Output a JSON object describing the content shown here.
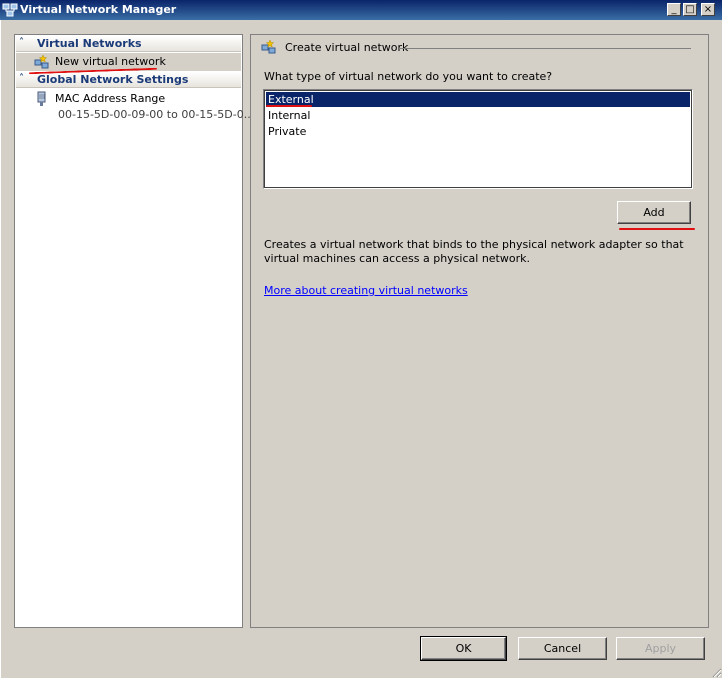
{
  "window": {
    "title": "Virtual Network Manager",
    "controls": {
      "minimize": "_",
      "maximize": "□",
      "close": "×"
    }
  },
  "sidebar": {
    "sections": [
      {
        "label": "Virtual Networks",
        "items": [
          {
            "label": "New virtual network",
            "icon": "new-network-icon"
          }
        ]
      },
      {
        "label": "Global Network Settings",
        "items": [
          {
            "label": "MAC Address Range",
            "sublabel": "00-15-5D-00-09-00 to 00-15-5D-0...",
            "icon": "nic-icon"
          }
        ]
      }
    ]
  },
  "main": {
    "group_title": "Create virtual network",
    "question": "What type of virtual network do you want to create?",
    "network_types": [
      "External",
      "Internal",
      "Private"
    ],
    "selected_type": "External",
    "add_button": "Add",
    "description": "Creates a virtual network that binds to the physical network adapter so that virtual machines can access a physical network.",
    "link": "More about creating virtual networks"
  },
  "footer": {
    "ok": "OK",
    "cancel": "Cancel",
    "apply": "Apply"
  },
  "colors": {
    "selection": "#0a246a",
    "annotation": "#e01010",
    "link": "#0000ff"
  }
}
